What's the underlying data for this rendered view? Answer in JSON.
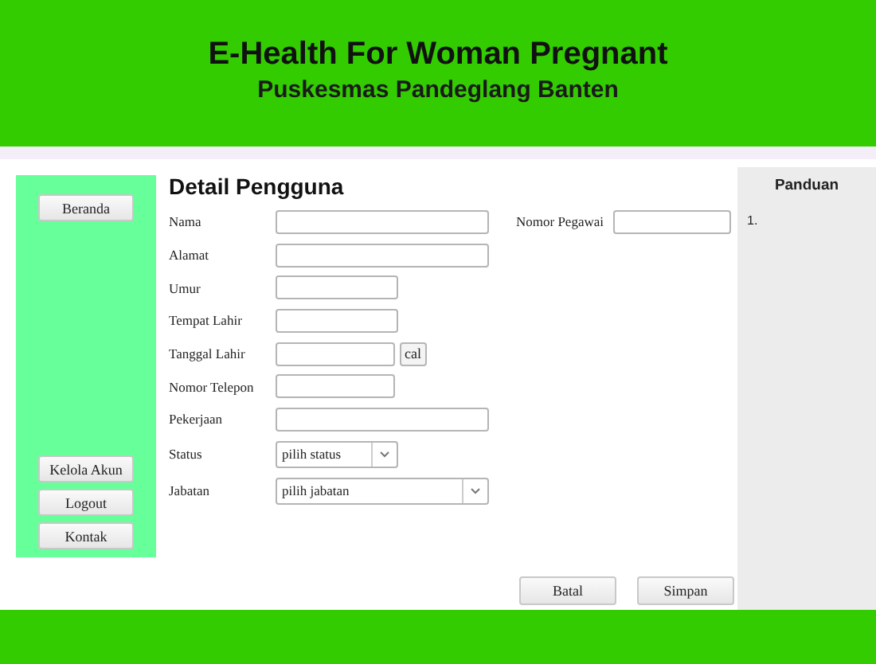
{
  "header": {
    "title": "E-Health For Woman Pregnant",
    "subtitle": "Puskesmas Pandeglang Banten"
  },
  "sidebar": {
    "top_buttons": [
      "Beranda"
    ],
    "bottom_buttons": [
      "Kelola Akun",
      "Logout",
      "Kontak"
    ]
  },
  "form": {
    "title": "Detail Pengguna",
    "side_field": {
      "label": "Nomor Pegawai"
    },
    "fields": [
      {
        "label": "Nama",
        "kind": "text"
      },
      {
        "label": "Alamat",
        "kind": "text"
      },
      {
        "label": "Umur",
        "kind": "text"
      },
      {
        "label": "Tempat Lahir",
        "kind": "text"
      },
      {
        "label": "Tanggal Lahir",
        "kind": "date",
        "button": "cal"
      },
      {
        "label": "Nomor Telepon",
        "kind": "text"
      },
      {
        "label": "Pekerjaan",
        "kind": "text"
      },
      {
        "label": "Status",
        "kind": "select",
        "value": "pilih status"
      },
      {
        "label": "Jabatan",
        "kind": "select",
        "value": "pilih jabatan"
      }
    ],
    "buttons": [
      "Batal",
      "Simpan"
    ]
  },
  "panel": {
    "title": "Panduan",
    "items": [
      "1."
    ]
  }
}
